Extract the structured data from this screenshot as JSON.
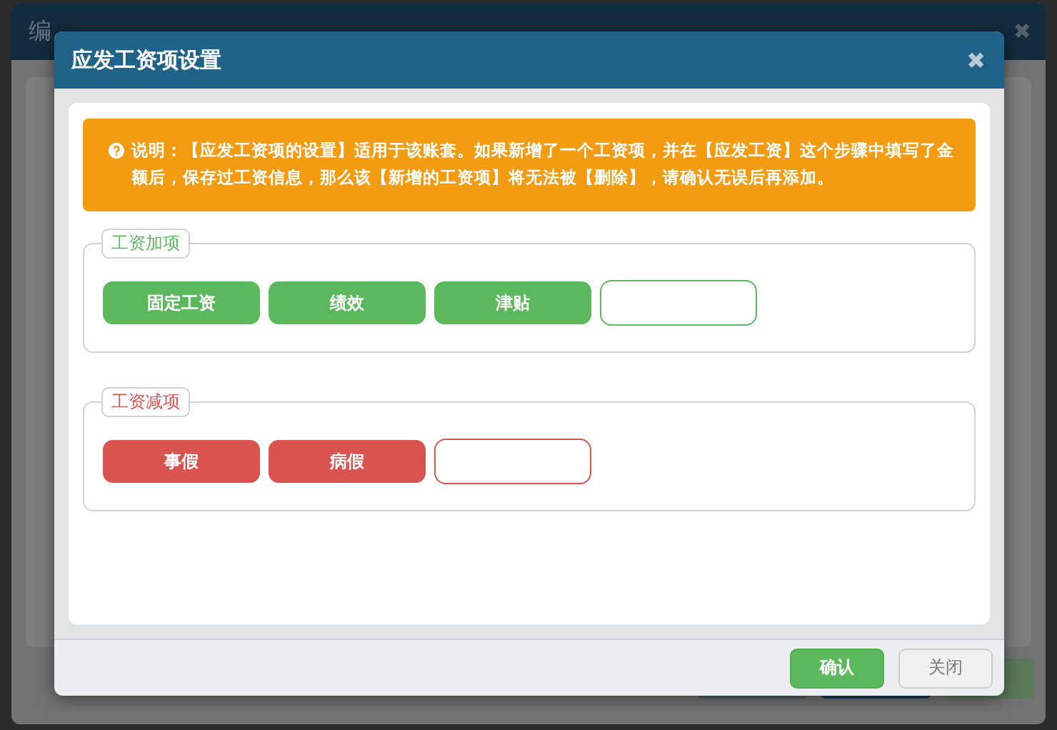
{
  "background_window": {
    "title": "编",
    "close": "✖"
  },
  "dialog": {
    "title": "应发工资项设置",
    "close": "✖",
    "notice": "说明：【应发工资项的设置】适用于该账套。如果新增了一个工资项，并在【应发工资】这个步骤中填写了金额后，保存过工资信息，那么该【新增的工资项】将无法被【删除】，请确认无误后再添加。",
    "groups": [
      {
        "legend": "工资加项",
        "kind": "plus",
        "items": [
          "固定工资",
          "绩效",
          "津贴"
        ]
      },
      {
        "legend": "工资减项",
        "kind": "minus",
        "items": [
          "事假",
          "病假"
        ]
      }
    ],
    "buttons": [
      {
        "label": "确认",
        "kind": "primary"
      },
      {
        "label": "关闭",
        "kind": "default"
      }
    ]
  }
}
